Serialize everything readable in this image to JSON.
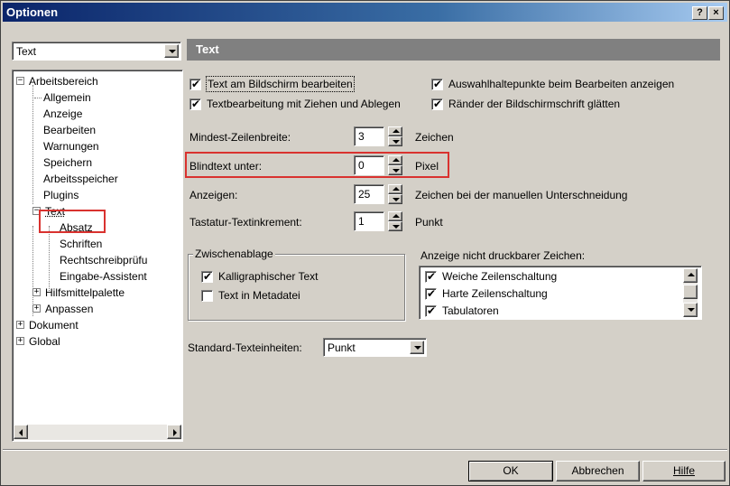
{
  "window": {
    "title": "Optionen",
    "help_button": "?",
    "close_button": "×"
  },
  "category_combo": {
    "value": "Text"
  },
  "tree": {
    "items": [
      {
        "label": "Arbeitsbereich",
        "expander": "−"
      },
      {
        "label": "Allgemein"
      },
      {
        "label": "Anzeige"
      },
      {
        "label": "Bearbeiten"
      },
      {
        "label": "Warnungen"
      },
      {
        "label": "Speichern"
      },
      {
        "label": "Arbeitsspeicher"
      },
      {
        "label": "Plugins"
      },
      {
        "label": "Text",
        "expander": "−",
        "selected": true
      },
      {
        "label": "Absatz"
      },
      {
        "label": "Schriften"
      },
      {
        "label": "Rechtschreibprüfu"
      },
      {
        "label": "Eingabe-Assistent"
      },
      {
        "label": "Hilfsmittelpalette",
        "expander": "+"
      },
      {
        "label": "Anpassen",
        "expander": "+"
      },
      {
        "label": "Dokument",
        "expander": "+"
      },
      {
        "label": "Global",
        "expander": "+"
      }
    ]
  },
  "panel": {
    "title": "Text",
    "checkboxes": {
      "text_am_bildschirm": {
        "label": "Text am Bildschirm bearbeiten",
        "checked": true
      },
      "textbearbeitung_ziehen": {
        "label": "Textbearbeitung mit Ziehen und Ablegen",
        "checked": true
      },
      "auswahlhaltepunkte": {
        "label": "Auswahlhaltepunkte beim Bearbeiten anzeigen",
        "checked": true
      },
      "raender_glaetten": {
        "label": "Ränder der Bildschirmschrift glätten",
        "checked": true
      }
    },
    "fields": {
      "mindest_zeilenbreite": {
        "label": "Mindest-Zeilenbreite:",
        "value": "3",
        "unit": "Zeichen"
      },
      "blindtext_unter": {
        "label": "Blindtext unter:",
        "value": "0",
        "unit": "Pixel"
      },
      "anzeigen": {
        "label": "Anzeigen:",
        "value": "25",
        "unit": "Zeichen bei der manuellen Unterschneidung"
      },
      "tastatur_textinkrement": {
        "label": "Tastatur-Textinkrement:",
        "value": "1",
        "unit": "Punkt"
      }
    },
    "zwischenablage": {
      "title": "Zwischenablage",
      "kalligraphischer_text": {
        "label": "Kalligraphischer Text",
        "checked": true
      },
      "text_in_metadatei": {
        "label": "Text in Metadatei",
        "checked": false
      }
    },
    "nicht_druckbar": {
      "title": "Anzeige nicht druckbarer Zeichen:",
      "items": [
        {
          "label": "Weiche Zeilenschaltung",
          "checked": true
        },
        {
          "label": "Harte Zeilenschaltung",
          "checked": true
        },
        {
          "label": "Tabulatoren",
          "checked": true
        }
      ]
    },
    "standard_texteinheiten": {
      "label": "Standard-Texteinheiten:",
      "value": "Punkt"
    }
  },
  "buttons": {
    "ok": "OK",
    "abbrechen": "Abbrechen",
    "hilfe": "Hilfe"
  },
  "colors": {
    "highlight": "#d9322f",
    "titlebar": "#0a246a",
    "panel_header": "#808080"
  }
}
